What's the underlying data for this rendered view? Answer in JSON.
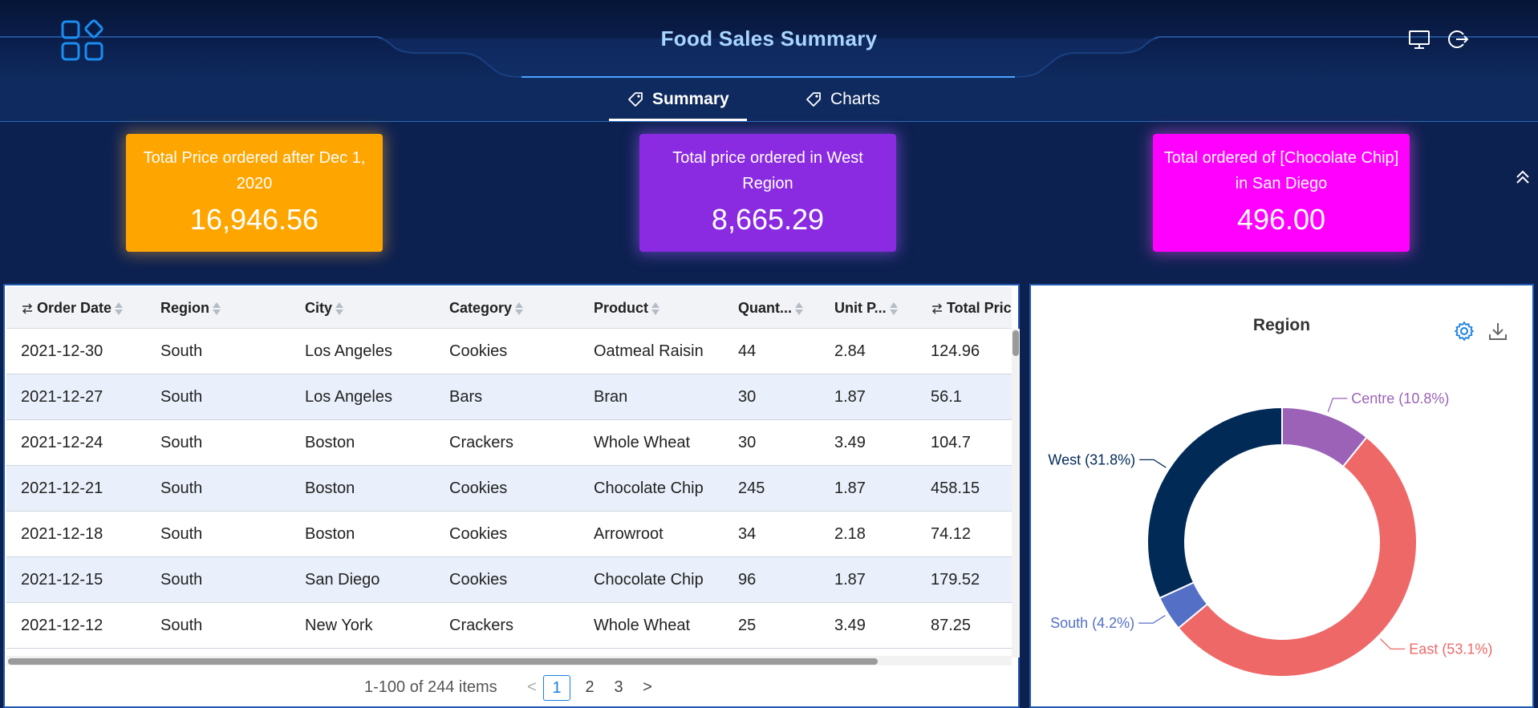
{
  "header": {
    "title": "Food Sales Summary",
    "icons": [
      "apps-icon",
      "monitor-icon",
      "logout-icon"
    ]
  },
  "tabs": [
    {
      "label": "Summary",
      "active": true
    },
    {
      "label": "Charts",
      "active": false
    }
  ],
  "kpis": [
    {
      "label": "Total Price ordered after Dec 1, 2020",
      "value": "16,946.56",
      "color": "#ffa500"
    },
    {
      "label": "Total price ordered in West Region",
      "value": "8,665.29",
      "color": "#8a2be2"
    },
    {
      "label": "Total ordered of [Chocolate Chip] in San Diego",
      "value": "496.00",
      "color": "#ff00ff"
    }
  ],
  "table": {
    "columns": [
      "Order Date",
      "Region",
      "City",
      "Category",
      "Product",
      "Quant...",
      "Unit P...",
      "Total Pric"
    ],
    "rows": [
      [
        "2021-12-30",
        "South",
        "Los Angeles",
        "Cookies",
        "Oatmeal Raisin",
        "44",
        "2.84",
        "124.96"
      ],
      [
        "2021-12-27",
        "South",
        "Los Angeles",
        "Bars",
        "Bran",
        "30",
        "1.87",
        "56.1"
      ],
      [
        "2021-12-24",
        "South",
        "Boston",
        "Crackers",
        "Whole Wheat",
        "30",
        "3.49",
        "104.7"
      ],
      [
        "2021-12-21",
        "South",
        "Boston",
        "Cookies",
        "Chocolate Chip",
        "245",
        "1.87",
        "458.15"
      ],
      [
        "2021-12-18",
        "South",
        "Boston",
        "Cookies",
        "Arrowroot",
        "34",
        "2.18",
        "74.12"
      ],
      [
        "2021-12-15",
        "South",
        "San Diego",
        "Cookies",
        "Chocolate Chip",
        "96",
        "1.87",
        "179.52"
      ],
      [
        "2021-12-12",
        "South",
        "New York",
        "Crackers",
        "Whole Wheat",
        "25",
        "3.49",
        "87.25"
      ]
    ],
    "pagination": {
      "info": "1-100 of 244 items",
      "pages": [
        "1",
        "2",
        "3"
      ],
      "current": "1",
      "prev": "<",
      "next": ">"
    }
  },
  "chart_data": {
    "type": "pie",
    "title": "Region",
    "donut": true,
    "categories": [
      "Centre",
      "East",
      "South",
      "West"
    ],
    "values": [
      10.8,
      53.1,
      4.2,
      31.8
    ],
    "labels": [
      "Centre (10.8%)",
      "East (53.1%)",
      "South (4.2%)",
      "West (31.8%)"
    ],
    "colors": [
      "#9b62b8",
      "#ef6868",
      "#5470c6",
      "#022a57"
    ],
    "legend": "none"
  }
}
